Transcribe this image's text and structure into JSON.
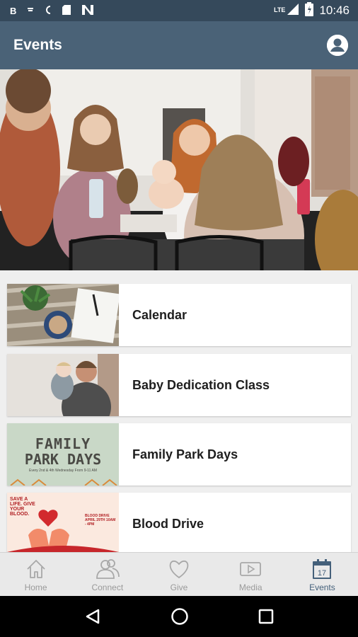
{
  "status_bar": {
    "time": "10:46",
    "network": "LTE",
    "icons": [
      "notification-b-icon",
      "download-icon",
      "clock-icon",
      "sd-card-icon",
      "n-logo-icon",
      "signal-icon",
      "battery-icon"
    ]
  },
  "app_bar": {
    "title": "Events",
    "profile_icon": "account-circle-icon"
  },
  "hero": {
    "description_icon": "hero-photo"
  },
  "events": [
    {
      "title": "Calendar",
      "thumb": "calendar-photo"
    },
    {
      "title": "Baby Dedication Class",
      "thumb": "baby-dedication-photo"
    },
    {
      "title": "Family Park Days",
      "thumb": "family-park-days-graphic",
      "thumb_text": {
        "line1": "FAMILY",
        "line2": "PARK DAYS",
        "line3": "Every 2nd & 4th Wednesday From 9-11 AM"
      }
    },
    {
      "title": "Blood Drive",
      "thumb": "blood-drive-graphic",
      "thumb_text": {
        "headline": "SAVE A LIFE. GIVE YOUR BLOOD.",
        "side": "BLOOD DRIVE APRIL 29TH 10AM - 4PM"
      }
    }
  ],
  "tabs": [
    {
      "label": "Home",
      "icon": "home-icon",
      "active": false
    },
    {
      "label": "Connect",
      "icon": "people-icon",
      "active": false
    },
    {
      "label": "Give",
      "icon": "heart-icon",
      "active": false
    },
    {
      "label": "Media",
      "icon": "play-icon",
      "active": false
    },
    {
      "label": "Events",
      "icon": "calendar-icon",
      "active": true,
      "icon_text": "17"
    }
  ],
  "colors": {
    "status_bar": "#35495b",
    "app_bar": "#4a6277",
    "tab_active": "#44607a",
    "tab_inactive": "#9a9a9a"
  }
}
